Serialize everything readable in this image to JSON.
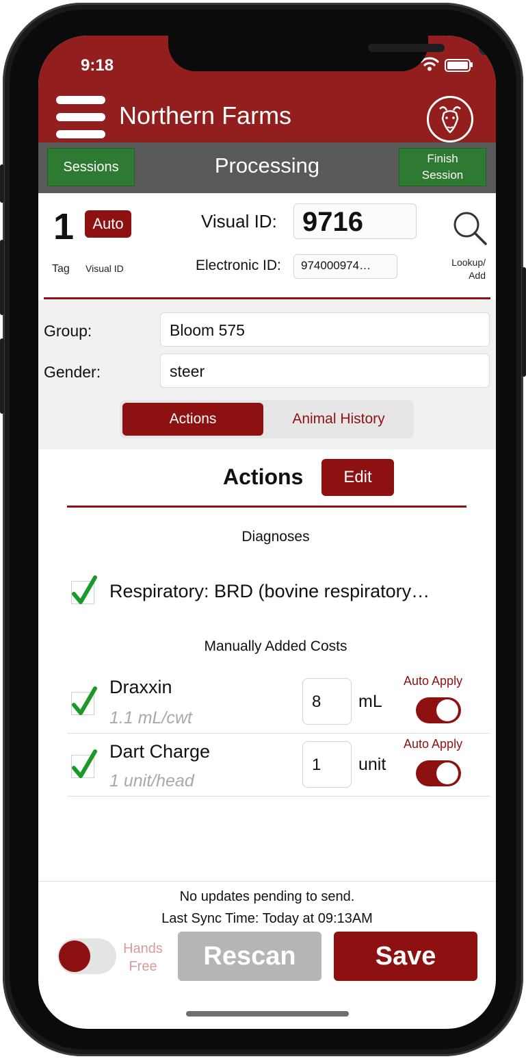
{
  "status_bar": {
    "time": "9:18",
    "signal": "····"
  },
  "header": {
    "title": "Northern Farms",
    "logo_icon": "bull-head-logo-icon"
  },
  "subheader": {
    "sessions_label": "Sessions",
    "title": "Processing",
    "finish_label_1": "Finish",
    "finish_label_2": "Session"
  },
  "id_panel": {
    "tag_number": "1",
    "auto_badge": "Auto",
    "tag_label": "Tag",
    "visual_id_small_label": "Visual ID",
    "visual_id_label": "Visual ID:",
    "visual_id_value": "9716",
    "electronic_id_label": "Electronic ID:",
    "electronic_id_value": "974000974…",
    "lookup_label_1": "Lookup/",
    "lookup_label_2": "Add"
  },
  "fields": {
    "group_label": "Group:",
    "group_value": "Bloom 575",
    "gender_label": "Gender:",
    "gender_value": "steer"
  },
  "tabs": {
    "actions": "Actions",
    "animal_history": "Animal History",
    "selected": "Actions"
  },
  "actions_section": {
    "title": "Actions",
    "edit_label": "Edit",
    "diagnoses_header": "Diagnoses",
    "diagnoses": [
      {
        "label": "Respiratory: BRD (bovine respiratory…",
        "checked": true
      }
    ],
    "costs_header": "Manually Added Costs",
    "costs": [
      {
        "name": "Draxxin",
        "rate": "1.1 mL/cwt",
        "quantity": "8",
        "unit": "mL",
        "auto_apply_label": "Auto Apply",
        "auto_apply": true,
        "checked": true
      },
      {
        "name": "Dart Charge",
        "rate": "1 unit/head",
        "quantity": "1",
        "unit": "unit",
        "auto_apply_label": "Auto Apply",
        "auto_apply": true,
        "checked": true
      }
    ]
  },
  "footer": {
    "sync_status": "No updates pending to send.",
    "last_sync": "Last Sync Time: Today at 09:13AM",
    "hands_free_label_1": "Hands",
    "hands_free_label_2": "Free",
    "hands_free_on": false,
    "rescan_label": "Rescan",
    "save_label": "Save"
  },
  "colors": {
    "brand_red": "#931e1e",
    "button_red": "#8e1112",
    "session_green": "#2f7a33",
    "subheader_gray": "#5a5a5a",
    "check_green": "#1a9a2a"
  }
}
